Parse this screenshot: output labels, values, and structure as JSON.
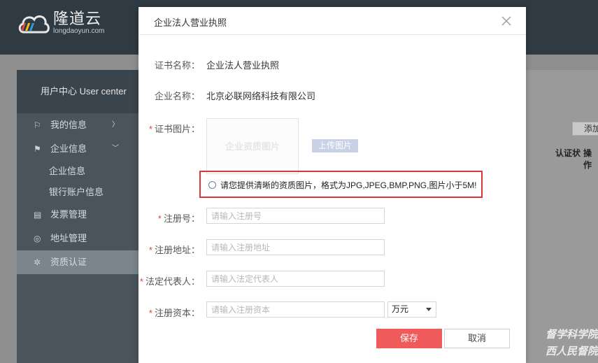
{
  "brand": {
    "name_cn": "隆道云",
    "name_en": "longdaoyun.com"
  },
  "sidebar": {
    "header": "用户中心 User center",
    "items": [
      {
        "label": "我的信息",
        "icon": "flag-icon"
      },
      {
        "label": "企业信息",
        "icon": "enterprise-icon"
      },
      {
        "label": "企业信息",
        "sub": true
      },
      {
        "label": "银行账户信息",
        "sub": true
      },
      {
        "label": "发票管理",
        "icon": "invoice-icon"
      },
      {
        "label": "地址管理",
        "icon": "location-icon"
      },
      {
        "label": "资质认证",
        "icon": "certificate-icon",
        "active": true
      }
    ]
  },
  "background_page": {
    "add_button": "添加",
    "col_status": "认证状",
    "col_action": "操作"
  },
  "watermark": {
    "line1": "督学科学院",
    "line2": "西人民督院"
  },
  "modal": {
    "title": "企业法人营业执照",
    "fields": {
      "cert_name_label": "证书名称：",
      "cert_name_value": "企业法人营业执照",
      "company_label": "企业名称：",
      "company_value": "北京必联网络科技有限公司",
      "cert_image_label": "证书图片：",
      "image_placeholder": "企业资质图片",
      "upload_label": "上传图片",
      "hint": "请您提供清晰的资质图片，格式为JPG,JPEG,BMP,PNG,图片小于5M!",
      "reg_no_label": "注册号：",
      "reg_no_placeholder": "请输入注册号",
      "reg_addr_label": "注册地址：",
      "reg_addr_placeholder": "请输入注册地址",
      "legal_rep_label": "法定代表人：",
      "legal_rep_placeholder": "请输入法定代表人",
      "capital_label": "注册资本：",
      "capital_placeholder": "请输入注册资本",
      "currency_selected": "万元"
    },
    "save_label": "保存",
    "cancel_label": "取消"
  },
  "colors": {
    "accent_red": "#ef5b5b",
    "required_star": "#e0403a",
    "hint_border": "#d9383a",
    "upload_button": "#c9d1e6",
    "topbar": "#2f3a43"
  }
}
